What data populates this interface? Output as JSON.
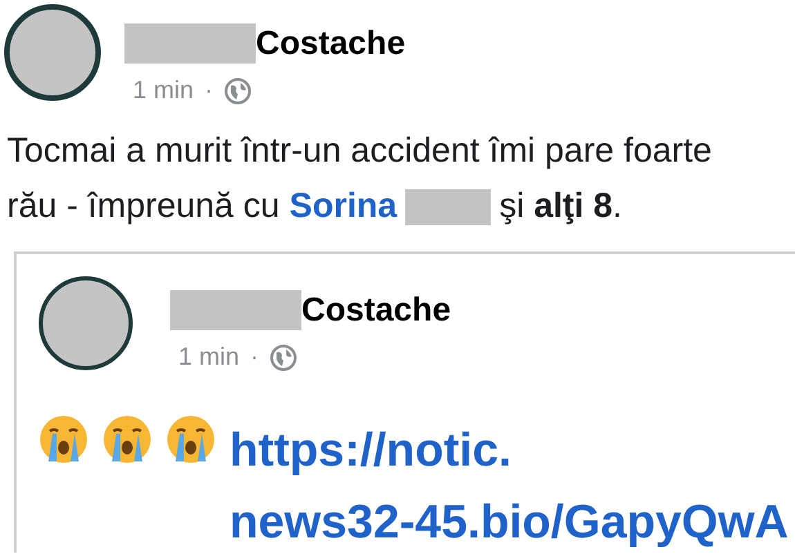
{
  "post": {
    "author": "Costache",
    "time": "1 min",
    "separator": "·",
    "public": true,
    "text": [
      {
        "kind": "text",
        "text": "Tocmai a murit într-un accident îmi pare foarte rău - împreună cu "
      },
      {
        "kind": "mention",
        "text": "Sorina"
      },
      {
        "kind": "redaction"
      },
      {
        "kind": "text",
        "text": "şi "
      },
      {
        "kind": "bold",
        "text": "alţi 8"
      },
      {
        "kind": "text",
        "text": "."
      }
    ],
    "shared": {
      "author": "Costache",
      "time": "1 min",
      "separator": "·",
      "public": true,
      "emojis": [
        {
          "kind": "crying"
        },
        {
          "kind": "crying"
        },
        {
          "kind": "crying"
        }
      ],
      "link_lines": [
        "https://notic.",
        "news32-45.bio/GapyQwA"
      ]
    }
  }
}
